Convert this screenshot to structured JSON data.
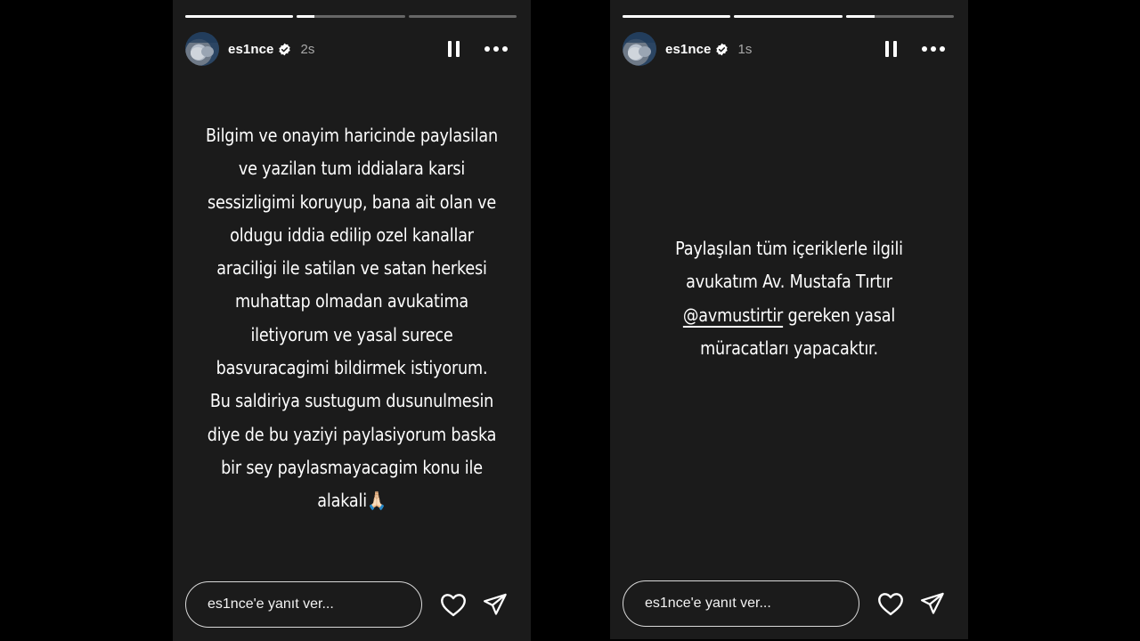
{
  "stories": [
    {
      "username": "es1nce",
      "time": "2s",
      "progress": [
        1,
        0.16,
        0
      ],
      "text_lines": [
        "Bilgim ve onayim haricinde paylasilan",
        "ve yazilan tum iddialara karsi",
        "sessizligimi koruyup, bana ait olan ve",
        "oldugu iddia edilip ozel kanallar",
        "araciligi ile satilan ve satan herkesi",
        "muhattap olmadan avukatima",
        "iletiyorum ve yasal surece",
        "basvuracagimi bildirmek istiyorum.",
        "Bu saldiriya sustugum dusunulmesin",
        "diye de bu yaziyi paylasiyorum baska",
        "bir sey paylasmayacagim konu ile",
        "alakali🙏🏻"
      ],
      "reply_placeholder": "es1nce'e yanıt ver..."
    },
    {
      "username": "es1nce",
      "time": "1s",
      "progress": [
        1,
        1,
        0.27
      ],
      "text_lines": [
        "Paylaşılan tüm içeriklerle ilgili",
        "avukatım Av. Mustafa Tırtır"
      ],
      "mention": "@avmustirtir",
      "mention_suffix": " gereken yasal",
      "last_line": "müracatları yapacaktır.",
      "reply_placeholder": "es1nce'e yanıt ver..."
    }
  ],
  "icons": {
    "verified": "verified-badge-icon",
    "pause": "pause-icon",
    "more": "more-options-icon",
    "heart": "heart-icon",
    "send": "send-icon"
  }
}
